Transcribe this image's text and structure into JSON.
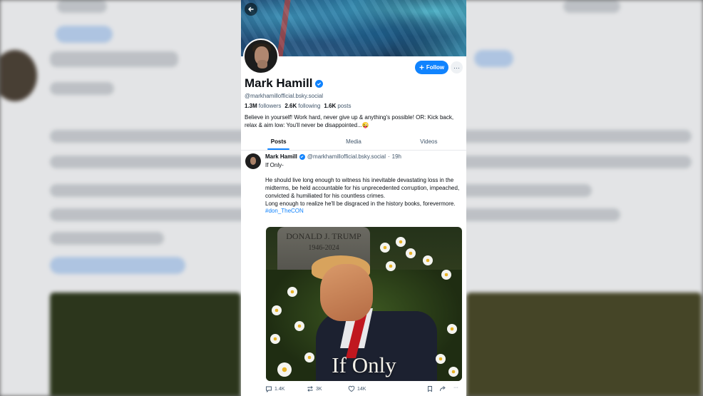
{
  "profile": {
    "display_name": "Mark Hamill",
    "handle": "@markhamillofficial.bsky.social",
    "followers_count": "1.3M",
    "followers_label": "followers",
    "following_count": "2.6K",
    "following_label": "following",
    "posts_count": "1.6K",
    "posts_label": "posts",
    "bio": "Believe in yourself! Work hard, never give up & anything's possible! OR: Kick back, relax & aim low: You'll never be disappointed...😜",
    "follow_label": "Follow",
    "more_label": "···"
  },
  "tabs": [
    {
      "label": "Posts",
      "active": true
    },
    {
      "label": "Media",
      "active": false
    },
    {
      "label": "Videos",
      "active": false
    }
  ],
  "post": {
    "author": "Mark Hamill",
    "handle": "@markhamillofficial.bsky.social",
    "time": "19h",
    "text_line1": "If Only-",
    "text_para": "He should live long enough to witness his inevitable devastating loss in the midterms, be held accountable for his unprecedented corruption, impeached, convicted & humiliated for his countless crimes.",
    "text_para2": "Long enough to realize he'll be disgraced in the history books, forevermore.",
    "hashtag": "#don_TheCON",
    "image": {
      "headstone_name": "DONALD J. TRUMP",
      "headstone_dates": "1946-2024",
      "caption": "If Only"
    },
    "replies": "1.4K",
    "reposts": "3K",
    "likes": "14K"
  },
  "icons": [
    "back-arrow-icon",
    "plus-icon",
    "verified-check-icon",
    "reply-icon",
    "repost-icon",
    "heart-icon",
    "bookmark-icon",
    "share-icon",
    "more-horizontal-icon"
  ],
  "colors": {
    "accent": "#1083fe",
    "muted_text": "#42576c",
    "text": "#0b0f14"
  }
}
